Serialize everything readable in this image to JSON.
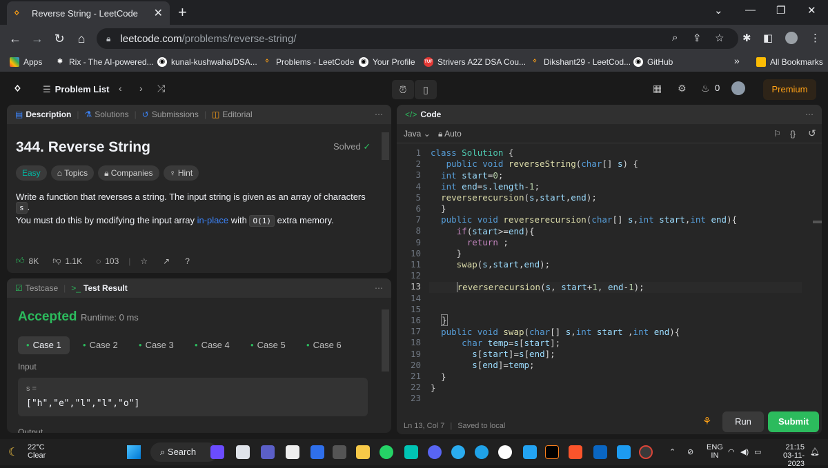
{
  "browser": {
    "tab_title": "Reverse String - LeetCode",
    "url_host": "leetcode.com",
    "url_path": "/problems/reverse-string/",
    "bookmarks": [
      {
        "label": "Apps"
      },
      {
        "label": "Rix - The AI-powered..."
      },
      {
        "label": "kunal-kushwaha/DSA..."
      },
      {
        "label": "Problems - LeetCode"
      },
      {
        "label": "Your Profile"
      },
      {
        "label": "Strivers A2Z DSA Cou..."
      },
      {
        "label": "Dikshant29 - LeetCod..."
      },
      {
        "label": "GitHub"
      }
    ],
    "more": "»",
    "all_bookmarks": "All Bookmarks"
  },
  "nav": {
    "problem_list": "Problem List",
    "streak": "0",
    "premium": "Premium"
  },
  "description_panel": {
    "tabs": [
      "Description",
      "Solutions",
      "Submissions",
      "Editorial"
    ],
    "title": "344. Reverse String",
    "solved": "Solved",
    "tags": [
      "Easy",
      "Topics",
      "Companies",
      "Hint"
    ],
    "para1": "Write a function that reverses a string. The input string is given as an array of characters",
    "para1_code": "s",
    "para1_end": ".",
    "para2_start": "You must do this by modifying the input array",
    "para2_link": "in-place",
    "para2_mid": "with",
    "para2_code": "O(1)",
    "para2_end": "extra memory.",
    "likes": "8K",
    "dislikes": "1.1K",
    "comments": "103"
  },
  "result_panel": {
    "tabs": [
      "Testcase",
      "Test Result"
    ],
    "status": "Accepted",
    "runtime": "Runtime: 0 ms",
    "cases": [
      "Case 1",
      "Case 2",
      "Case 3",
      "Case 4",
      "Case 5",
      "Case 6"
    ],
    "input_label": "Input",
    "var_name": "s =",
    "input_value": "[\"h\",\"e\",\"l\",\"l\",\"o\"]",
    "output_label": "Output"
  },
  "code_panel": {
    "title": "Code",
    "language": "Java",
    "auto": "Auto",
    "status": "Ln 13, Col 7",
    "saved": "Saved to local",
    "run": "Run",
    "submit": "Submit",
    "line_numbers": [
      "1",
      "2",
      "3",
      "4",
      "5",
      "6",
      "7",
      "8",
      "9",
      "10",
      "11",
      "12",
      "13",
      "14",
      "15",
      "16",
      "17",
      "18",
      "19",
      "20",
      "21",
      "22",
      "23"
    ]
  },
  "taskbar": {
    "temp": "22°C",
    "weather": "Clear",
    "search": "Search",
    "lang1": "ENG",
    "lang2": "IN",
    "time": "21:15",
    "date": "03-11-2023"
  }
}
